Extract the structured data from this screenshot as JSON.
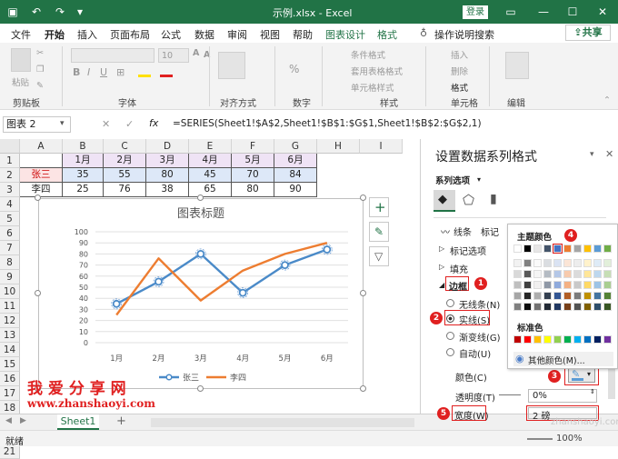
{
  "window": {
    "title": "示例.xlsx - Excel",
    "login": "登录"
  },
  "menu": {
    "items": [
      "文件",
      "开始",
      "插入",
      "页面布局",
      "公式",
      "数据",
      "审阅",
      "视图",
      "帮助",
      "图表设计",
      "格式"
    ],
    "search": "操作说明搜索",
    "share": "共享"
  },
  "ribbon": {
    "groups": [
      "剪贴板",
      "字体",
      "对齐方式",
      "数字",
      "样式",
      "单元格",
      "编辑"
    ],
    "paste": "粘贴",
    "font_size": "10",
    "cond_format": "条件格式",
    "table_format": "套用表格格式",
    "cell_style": "单元格样式",
    "insert": "插入",
    "delete": "删除",
    "format": "格式",
    "number_pct": "%",
    "number_comma": ","
  },
  "formula_bar": {
    "name_box": "图表 2",
    "fx": "fx",
    "formula": "=SERIES(Sheet1!$A$2,Sheet1!$B$1:$G$1,Sheet1!$B$2:$G$2,1)"
  },
  "grid": {
    "columns": [
      "A",
      "B",
      "C",
      "D",
      "E",
      "F",
      "G",
      "H",
      "I"
    ],
    "rows": [
      "1",
      "2",
      "3",
      "4",
      "5",
      "6",
      "7",
      "8",
      "9",
      "10",
      "11",
      "12",
      "13",
      "14",
      "15",
      "16",
      "17",
      "18",
      "19",
      "20",
      "21"
    ],
    "header": [
      "",
      "1月",
      "2月",
      "3月",
      "4月",
      "5月",
      "6月"
    ],
    "r2": [
      "张三",
      "35",
      "55",
      "80",
      "45",
      "70",
      "84"
    ],
    "r3": [
      "李四",
      "25",
      "76",
      "38",
      "65",
      "80",
      "90"
    ]
  },
  "chart_data": {
    "type": "line",
    "title": "图表标题",
    "categories": [
      "1月",
      "2月",
      "3月",
      "4月",
      "5月",
      "6月"
    ],
    "series": [
      {
        "name": "张三",
        "values": [
          35,
          55,
          80,
          45,
          70,
          84
        ],
        "color": "#4a8ac8"
      },
      {
        "name": "李四",
        "values": [
          25,
          76,
          38,
          65,
          80,
          90
        ],
        "color": "#ed7d31"
      }
    ],
    "ylim": [
      0,
      100
    ],
    "yticks": [
      0,
      10,
      20,
      30,
      40,
      50,
      60,
      70,
      80,
      90,
      100
    ],
    "grid": true,
    "legend": "bottom"
  },
  "sheet": {
    "tab": "Sheet1",
    "add": "+"
  },
  "status": {
    "ready": "就绪",
    "zoom": "100%"
  },
  "panel": {
    "title": "设置数据系列格式",
    "series_options": "系列选项",
    "tabs": [
      "线条",
      "标记"
    ],
    "sections": [
      "标记选项",
      "填充",
      "边框"
    ],
    "radio": [
      "无线条(N)",
      "实线(S)",
      "渐变线(G)",
      "自动(U)"
    ],
    "color_label": "颜色(C)",
    "transparency_label": "透明度(T)",
    "transparency": "0%",
    "width_label": "宽度(W)",
    "width": "2 磅",
    "badges": [
      "1",
      "2",
      "3",
      "4",
      "5"
    ]
  },
  "palette": {
    "theme_title": "主题颜色",
    "standard_title": "标准色",
    "more": "其他颜色(M)...",
    "theme_top": [
      "#ffffff",
      "#000000",
      "#e7e6e6",
      "#44546a",
      "#4472c4",
      "#ed7d31",
      "#a5a5a5",
      "#ffc000",
      "#5b9bd5",
      "#70ad47"
    ],
    "standard": [
      "#c00000",
      "#ff0000",
      "#ffc000",
      "#ffff00",
      "#92d050",
      "#00b050",
      "#00b0f0",
      "#0070c0",
      "#002060",
      "#7030a0"
    ]
  },
  "watermark": {
    "cn": "我 爱 分 享 网",
    "url": "www.zhanshaoyi.com",
    "url2": "zhanshaoyi.com"
  }
}
